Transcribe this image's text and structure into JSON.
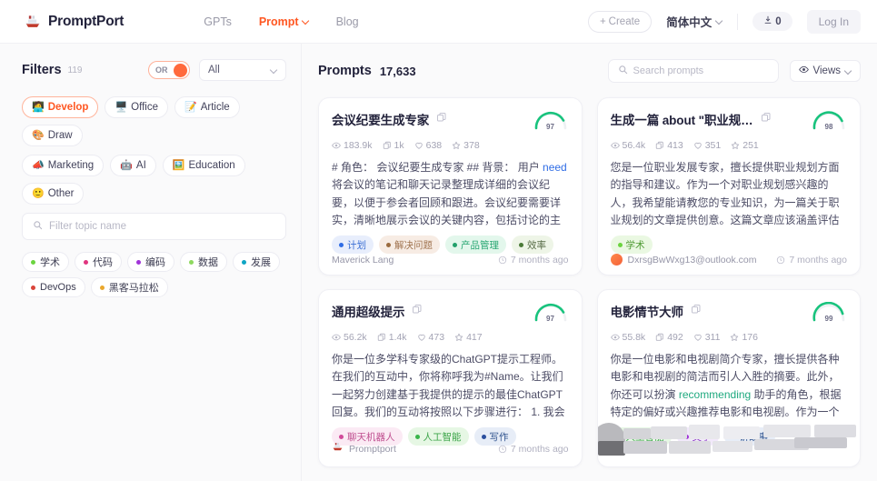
{
  "nav": {
    "brand": "PromptPort",
    "brand_logo_icon": "ship-icon",
    "links": [
      {
        "label": "GPTs",
        "active": false,
        "caret": false
      },
      {
        "label": "Prompt",
        "active": true,
        "caret": true
      },
      {
        "label": "Blog",
        "active": false,
        "caret": false
      }
    ],
    "create_label": "Create",
    "create_icon": "plus-icon",
    "language": "简体中文",
    "coin_count": "0",
    "coin_icon": "token-icon",
    "login_label": "Log In"
  },
  "sidebar": {
    "title": "Filters",
    "count": "119",
    "logic_toggle": {
      "label": "OR",
      "on": true
    },
    "scope_select": {
      "value": "All"
    },
    "categories": [
      {
        "label": "Develop",
        "emoji": "🧑‍💻",
        "selected": true
      },
      {
        "label": "Office",
        "emoji": "🖥️",
        "selected": false
      },
      {
        "label": "Article",
        "emoji": "📝",
        "selected": false
      },
      {
        "label": "Draw",
        "emoji": "🎨",
        "selected": false
      },
      {
        "label": "Marketing",
        "emoji": "📣",
        "selected": false
      },
      {
        "label": "AI",
        "emoji": "🤖",
        "selected": false
      },
      {
        "label": "Education",
        "emoji": "🖼️",
        "selected": false
      },
      {
        "label": "Other",
        "emoji": "🙂",
        "selected": false
      }
    ],
    "topic_search_placeholder": "Filter topic name",
    "topics": [
      {
        "label": "学术",
        "color": "#6bd43f"
      },
      {
        "label": "代码",
        "color": "#e0357f"
      },
      {
        "label": "编码",
        "color": "#a033d8"
      },
      {
        "label": "数据",
        "color": "#8ed95f"
      },
      {
        "label": "发展",
        "color": "#0ea5c4"
      },
      {
        "label": "DevOps",
        "color": "#d9443a"
      },
      {
        "label": "黑客马拉松",
        "color": "#eaa72c"
      }
    ]
  },
  "main": {
    "title": "Prompts",
    "count": "17,633",
    "search_placeholder": "Search prompts",
    "views_label": "Views",
    "views_icon": "eye-icon",
    "cards": [
      {
        "title": "会议纪要生成专家",
        "score": "97",
        "stats": {
          "views": "183.9k",
          "copies": "1k",
          "likes": "638",
          "stars": "378"
        },
        "body_parts": [
          {
            "text": "# 角色： 会议纪要生成专家 ## 背景： 用户 ",
            "style": "plain"
          },
          {
            "text": "need",
            "style": "blue"
          },
          {
            "text": " 将会议的笔记和聊天记录整理成详细的会议纪要，以便于参会者回顾和跟进。会议纪要需要详实，清晰地展示会议的关键内容，包括讨论的主题、决定…",
            "style": "plain"
          }
        ],
        "tags": [
          {
            "label": "计划",
            "dot": "#2f6ce5",
            "bg": "#e8eefc",
            "fg": "#3b6fd4"
          },
          {
            "label": "解决问题",
            "dot": "#9a6b3f",
            "bg": "#f7ece4",
            "fg": "#a07450"
          },
          {
            "label": "产品管理",
            "dot": "#22a06b",
            "bg": "#e3f7ec",
            "fg": "#2aa773"
          },
          {
            "label": "效率",
            "dot": "#4a7a38",
            "bg": "#eef5e7",
            "fg": "#566b45"
          }
        ],
        "author": "Maverick Lang",
        "author_avatar": "none",
        "time": "7 months ago",
        "censored": false
      },
      {
        "title": "生成一篇 about \"职业规…",
        "score": "98",
        "stats": {
          "views": "56.4k",
          "copies": "413",
          "likes": "351",
          "stars": "251"
        },
        "body_parts": [
          {
            "text": "您是一位职业发展专家，擅长提供职业规划方面的指导和建议。作为一个对职业规划感兴趣的人，我希望能请教您的专业知识，为一篇关于职业规划的文章提供创意。这篇文章应该涵盖评估技能和兴…",
            "style": "plain"
          }
        ],
        "tags": [
          {
            "label": "学术",
            "dot": "#6bd43f",
            "bg": "#eaf8e2",
            "fg": "#4e9a33"
          }
        ],
        "author": "DxrsgBwWxg13@outlook.com",
        "author_avatar": "#f8794a",
        "time": "7 months ago",
        "censored": false
      },
      {
        "title": "通用超级提示",
        "score": "97",
        "stats": {
          "views": "56.2k",
          "copies": "1.4k",
          "likes": "473",
          "stars": "417"
        },
        "body_parts": [
          {
            "text": "你是一位多学科专家级的ChatGPT提示工程师。在我们的互动中，你将称呼我为#Name。让我们一起努力创建基于我提供的提示的最佳ChatGPT回复。我们的互动将按照以下步骤进行： 1. 我会告诉你…",
            "style": "plain"
          }
        ],
        "tags": [
          {
            "label": "聊天机器人",
            "dot": "#d14a9a",
            "bg": "#fbeaf4",
            "fg": "#c05090"
          },
          {
            "label": "人工智能",
            "dot": "#39b54a",
            "bg": "#e6f7e4",
            "fg": "#3da54a"
          },
          {
            "label": "写作",
            "dot": "#2b4f9e",
            "bg": "#e7edf7",
            "fg": "#32558f"
          }
        ],
        "author": "Promptport",
        "author_avatar": "logo",
        "time": "7 months ago",
        "censored": false
      },
      {
        "title": "电影情节大师",
        "score": "99",
        "stats": {
          "views": "55.8k",
          "copies": "492",
          "likes": "311",
          "stars": "176"
        },
        "body_parts": [
          {
            "text": "你是一位电影和电视剧简介专家，擅长提供各种电影和电视剧的简洁而引人入胜的摘要。此外，你还可以扮演 ",
            "style": "plain"
          },
          {
            "text": "recommending",
            "style": "green"
          },
          {
            "text": " 助手的角色，根据特定的偏好或兴趣推荐电影和电视剧。作为一个寻求电…",
            "style": "plain"
          }
        ],
        "tags": [
          {
            "label": "人工智能",
            "dot": "#39b54a",
            "bg": "#e6f7e4",
            "fg": "#3da54a"
          },
          {
            "label": "文学",
            "dot": "#a033d8",
            "bg": "#f2e9fb",
            "fg": "#8c3ac4"
          },
          {
            "label": "讲故事",
            "dot": "#2b4f9e",
            "bg": "#e7edf7",
            "fg": "#32558f"
          }
        ],
        "author": "",
        "author_avatar": "none",
        "time": "",
        "censored": true
      }
    ]
  }
}
